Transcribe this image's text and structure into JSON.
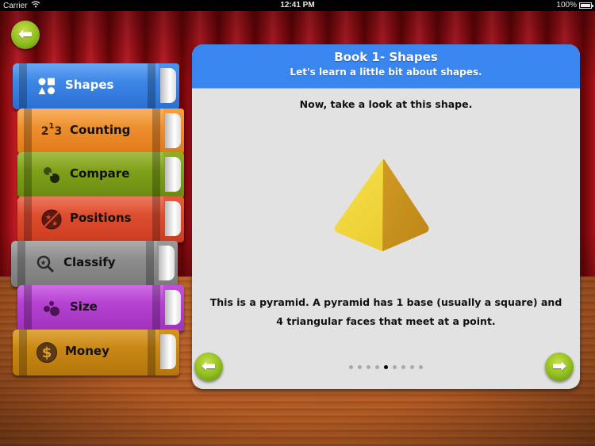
{
  "status_bar": {
    "carrier": "Carrier",
    "wifi_icon": "wifi-icon",
    "time": "12:41 PM",
    "battery_percent": "100%",
    "battery_icon": "battery-icon"
  },
  "nav": {
    "back_icon": "arrow-left-icon",
    "back_glyph": "⬅"
  },
  "books": [
    {
      "label": "Shapes",
      "icon": "shapes-icon",
      "color": "#2f7de0"
    },
    {
      "label": "Counting",
      "icon": "numbers-icon",
      "color": "#f08a26"
    },
    {
      "label": "Compare",
      "icon": "compare-icon",
      "color": "#7a9a14"
    },
    {
      "label": "Positions",
      "icon": "positions-icon",
      "color": "#e0482a"
    },
    {
      "label": "Classify",
      "icon": "magnifier-star-icon",
      "color": "#8a8a8a"
    },
    {
      "label": "Size",
      "icon": "size-dots-icon",
      "color": "#b33fd0"
    },
    {
      "label": "Money",
      "icon": "dollar-icon",
      "color": "#c8860f"
    }
  ],
  "counting_glyph": {
    "a": "2",
    "b": "1",
    "c": "3"
  },
  "money_glyph": "$",
  "panel": {
    "title": "Book 1- Shapes",
    "subtitle": "Let's learn a little bit about shapes.",
    "prompt": "Now, take a look at this shape.",
    "image": "yellow-pyramid",
    "description": "This is a pyramid. A pyramid has 1 base (usually a square) and 4 triangular faces that meet at a point.",
    "prev_glyph": "⬅",
    "next_glyph": "➡",
    "pager": {
      "total": 9,
      "current": 5
    }
  },
  "colors": {
    "header_blue": "#3a86f0",
    "button_green": "#8fbc1e",
    "curtain_red": "#b0141c",
    "pyramid_light": "#f0d83a",
    "pyramid_dark": "#c98f1f"
  }
}
